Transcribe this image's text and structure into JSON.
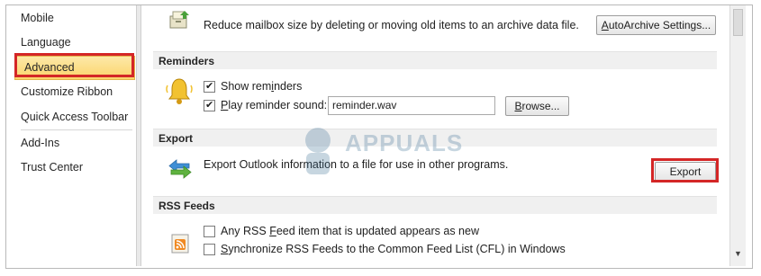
{
  "sidebar": {
    "items": [
      {
        "label": "Mobile"
      },
      {
        "label": "Language"
      },
      {
        "label": "Advanced",
        "selected": true
      },
      {
        "label": "Customize Ribbon"
      },
      {
        "label": "Quick Access Toolbar"
      },
      {
        "label": "Add-Ins"
      },
      {
        "label": "Trust Center"
      }
    ]
  },
  "autoarchive": {
    "description": "Reduce mailbox size by deleting or moving old items to an archive data file.",
    "button_label_pre": "",
    "button_label_u": "A",
    "button_label_post": "utoArchive Settings...",
    "icon": "archive-icon"
  },
  "reminders": {
    "header": "Reminders",
    "show_label_pre": "Show rem",
    "show_label_u": "i",
    "show_label_post": "nders",
    "play_label_pre": "",
    "play_label_u": "P",
    "play_label_post": "lay reminder sound:",
    "sound_value": "reminder.wav",
    "browse_pre": "",
    "browse_u": "B",
    "browse_post": "rowse...",
    "icon": "bell-icon"
  },
  "export": {
    "header": "Export",
    "description": "Export Outlook information to a file for use in other programs.",
    "button_label": "Export",
    "icon": "export-arrows-icon"
  },
  "rss": {
    "header": "RSS Feeds",
    "opt1_pre": "Any RSS ",
    "opt1_u": "F",
    "opt1_post": "eed item that is updated appears as new",
    "opt2_pre": "",
    "opt2_u": "S",
    "opt2_post": "ynchronize RSS Feeds to the Common Feed List (CFL) in Windows",
    "icon": "rss-icon"
  },
  "watermark": {
    "text": "APPUALS"
  },
  "colors": {
    "highlight": "#d42626",
    "selected_bg": "#fbd46a"
  }
}
